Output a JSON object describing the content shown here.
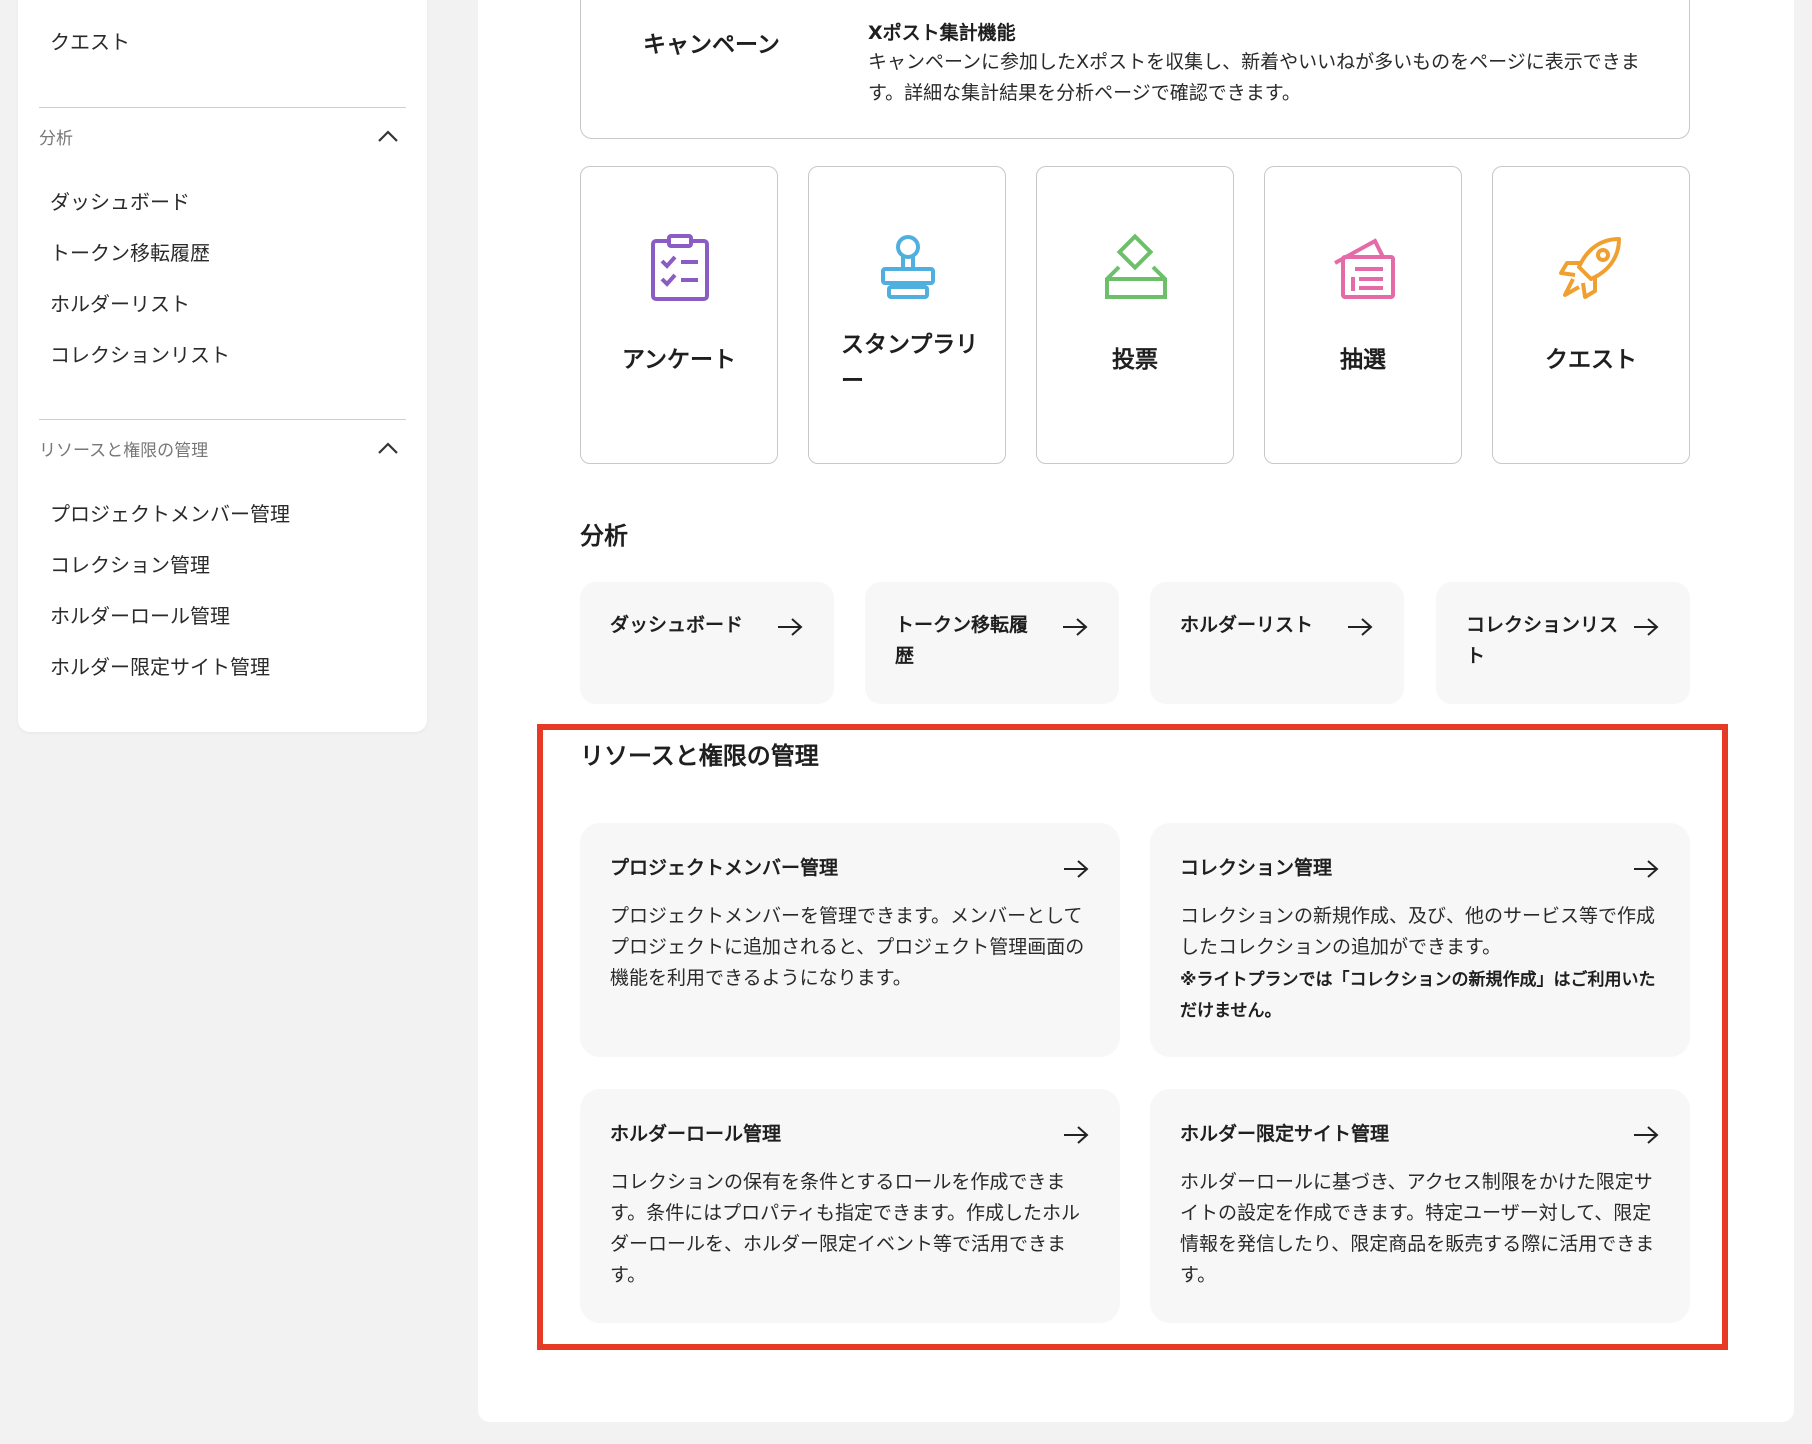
{
  "sidebar": {
    "top_item": "クエスト",
    "analysis": {
      "label": "分析",
      "items": [
        "ダッシュボード",
        "トークン移転履歴",
        "ホルダーリスト",
        "コレクションリスト"
      ]
    },
    "resources": {
      "label": "リソースと権限の管理",
      "items": [
        "プロジェクトメンバー管理",
        "コレクション管理",
        "ホルダーロール管理",
        "ホルダー限定サイト管理"
      ]
    }
  },
  "campaign": {
    "label": "キャンペーン",
    "feature_title": "Xポスト集計機能",
    "feature_desc": "キャンペーンに参加したXポストを収集し、新着やいいねが多いものをページに表示できます。詳細な集計結果を分析ページで確認できます。"
  },
  "features": [
    {
      "label": "アンケート",
      "icon": "clipboard-checklist-icon",
      "color": "#8b5cc4"
    },
    {
      "label": "スタンプラリー",
      "icon": "stamp-icon",
      "color": "#4fb0e0"
    },
    {
      "label": "投票",
      "icon": "ballot-box-icon",
      "color": "#6cc06a"
    },
    {
      "label": "抽選",
      "icon": "lottery-ticket-icon",
      "color": "#e46aa8"
    },
    {
      "label": "クエスト",
      "icon": "rocket-icon",
      "color": "#f0a030"
    }
  ],
  "analysis_section": {
    "title": "分析",
    "cards": [
      "ダッシュボード",
      "トークン移転履歴",
      "ホルダーリスト",
      "コレクションリスト"
    ]
  },
  "resources_section": {
    "title": "リソースと権限の管理",
    "highlight_color": "#e43a26",
    "cards": [
      {
        "title": "プロジェクトメンバー管理",
        "desc": "プロジェクトメンバーを管理できます。メンバーとしてプロジェクトに追加されると、プロジェクト管理画面の機能を利用できるようになります。"
      },
      {
        "title": "コレクション管理",
        "desc": "コレクションの新規作成、及び、他のサービス等で作成したコレクションの追加ができます。",
        "note": "※ライトプランでは「コレクションの新規作成」はご利用いただけません。"
      },
      {
        "title": "ホルダーロール管理",
        "desc": "コレクションの保有を条件とするロールを作成できます。条件にはプロパティも指定できます。作成したホルダーロールを、ホルダー限定イベント等で活用できます。"
      },
      {
        "title": "ホルダー限定サイト管理",
        "desc": "ホルダーロールに基づき、アクセス制限をかけた限定サイトの設定を作成できます。特定ユーザー対して、限定情報を発信したり、限定商品を販売する際に活用できます。"
      }
    ]
  }
}
